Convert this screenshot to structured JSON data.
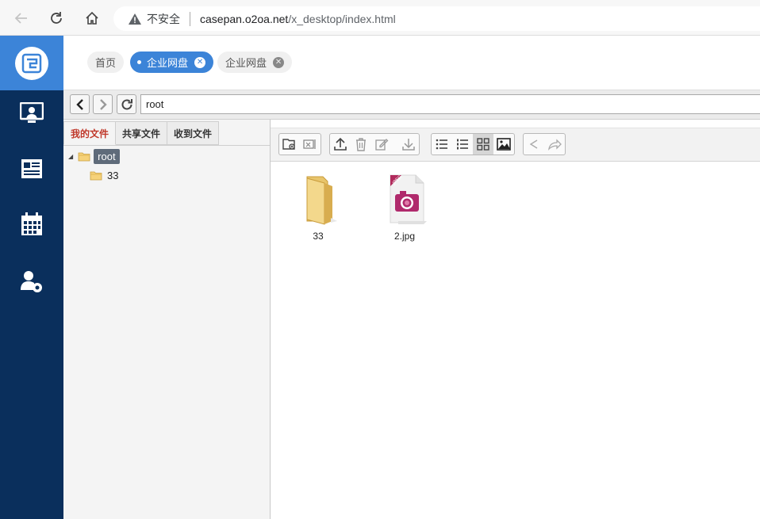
{
  "browser": {
    "insecure_label": "不安全",
    "url_host": "casepan.o2oa.net",
    "url_path": "/x_desktop/index.html"
  },
  "sidebar": {
    "items": [
      {
        "icon": "monitor-user-icon"
      },
      {
        "icon": "news-icon"
      },
      {
        "icon": "calendar-icon"
      },
      {
        "icon": "user-settings-icon"
      }
    ],
    "colors": {
      "background": "#0a2f5c",
      "logo_bg": "#3c84d8"
    }
  },
  "top_tabs": {
    "home": "首页",
    "active": "企业网盘",
    "other": "企业网盘"
  },
  "path_bar": {
    "path_value": "root"
  },
  "tree": {
    "tabs": [
      "我的文件",
      "共享文件",
      "收到文件"
    ],
    "root_label": "root",
    "child_label": "33"
  },
  "files": [
    {
      "name": "33",
      "type": "folder"
    },
    {
      "name": "2.jpg",
      "type": "jpeg",
      "badge": "JPEG"
    }
  ]
}
